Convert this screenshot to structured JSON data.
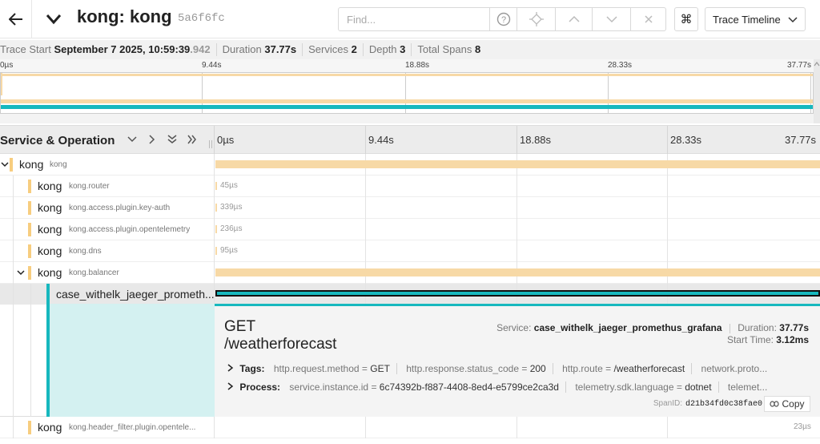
{
  "header": {
    "title": "kong: kong",
    "trace_id": "5a6f6fc",
    "find_placeholder": "Find...",
    "view_select": "Trace Timeline"
  },
  "summary": {
    "trace_start_label": "Trace Start",
    "trace_start_value": "September 7 2025, 10:59:39",
    "trace_start_ms": ".942",
    "duration_label": "Duration",
    "duration_value": "37.77s",
    "services_label": "Services",
    "services_value": "2",
    "depth_label": "Depth",
    "depth_value": "3",
    "total_spans_label": "Total Spans",
    "total_spans_value": "8"
  },
  "ticks": [
    "0µs",
    "9.44s",
    "18.88s",
    "28.33s",
    "37.77s"
  ],
  "columns": {
    "service_operation": "Service & Operation"
  },
  "spans": [
    {
      "service": "kong",
      "operation": "kong",
      "duration": "",
      "depth": 0
    },
    {
      "service": "kong",
      "operation": "kong.router",
      "duration": "45µs",
      "depth": 1
    },
    {
      "service": "kong",
      "operation": "kong.access.plugin.key-auth",
      "duration": "339µs",
      "depth": 1
    },
    {
      "service": "kong",
      "operation": "kong.access.plugin.opentelemetry",
      "duration": "236µs",
      "depth": 1
    },
    {
      "service": "kong",
      "operation": "kong.dns",
      "duration": "95µs",
      "depth": 1
    },
    {
      "service": "kong",
      "operation": "kong.balancer",
      "duration": "",
      "depth": 1
    },
    {
      "service": "case_withelk_jaeger_prometh...",
      "operation": "",
      "duration": "",
      "depth": 2
    },
    {
      "service": "kong",
      "operation": "kong.header_filter.plugin.opentele...",
      "duration": "23µs",
      "depth": 1
    }
  ],
  "detail": {
    "operation_line1": "GET",
    "operation_line2": "/weatherforecast",
    "service_label": "Service:",
    "service_value": "case_withelk_jaeger_promethus_grafana",
    "duration_label": "Duration:",
    "duration_value": "37.77s",
    "start_time_label": "Start Time:",
    "start_time_value": "3.12ms",
    "tags_label": "Tags:",
    "tags": [
      {
        "key": "http.request.method",
        "value": "GET"
      },
      {
        "key": "http.response.status_code",
        "value": "200"
      },
      {
        "key": "http.route",
        "value": "/weatherforecast"
      },
      {
        "key": "network.proto...",
        "value": ""
      }
    ],
    "process_label": "Process:",
    "process": [
      {
        "key": "service.instance.id",
        "value": "6c74392b-f887-4408-8ed4-e5799ce2ca3d"
      },
      {
        "key": "telemetry.sdk.language",
        "value": "dotnet"
      },
      {
        "key": "telemet...",
        "value": ""
      }
    ],
    "span_id_label": "SpanID:",
    "span_id_value": "d21b34fd0c38fae0",
    "copy_label": "Copy"
  },
  "colors": {
    "kong": "#f7d9a6",
    "service_teal": "#17b8be"
  }
}
